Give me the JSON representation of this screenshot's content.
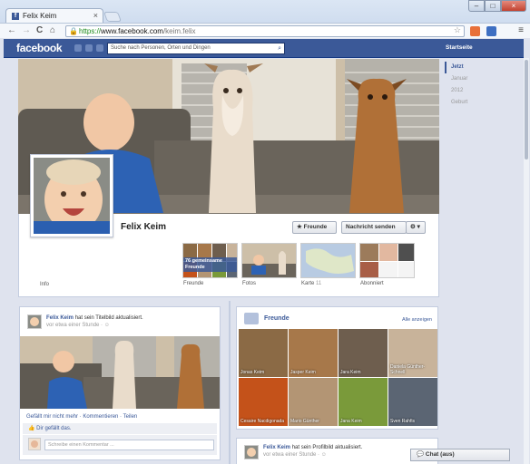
{
  "browser": {
    "tab_title": "Felix Keim",
    "tab_close": "×",
    "window_min": "–",
    "window_max": "□",
    "window_close": "×",
    "nav_back": "←",
    "nav_forward": "→",
    "nav_reload": "C",
    "nav_home": "⌂",
    "url_scheme": "https://",
    "url_domain": "www.facebook.com",
    "url_path": "/keim.felix",
    "menu": "≡"
  },
  "facebook_bar": {
    "logo": "facebook",
    "search_placeholder": "Suche nach Personen, Orten und Dingen",
    "home_link": "Startseite"
  },
  "scrubber": {
    "items": [
      "Jetzt",
      "Januar",
      "2012",
      "Geburt"
    ]
  },
  "profile": {
    "name": "Felix Keim",
    "friends_button": "★ Freunde",
    "message_button": "Nachricht senden",
    "gear_button": "⚙ ▾",
    "info_label": "Info",
    "mutual_friends_overlay": "76 gemeinsame Freunde",
    "tiles": [
      {
        "label": "Freunde"
      },
      {
        "label": "Fotos"
      },
      {
        "label": "Karte",
        "count": "11"
      },
      {
        "label": "Abonniert"
      }
    ]
  },
  "post1": {
    "author": "Felix Keim",
    "action": "hat sein Titelbild aktualisiert.",
    "time": "vor etwa einer Stunde · ☺",
    "actions": "Gefällt mir nicht mehr · Kommentieren · Teilen",
    "likes": "Dir gefällt das.",
    "comment_placeholder": "Schreibe einen Kommentar ..."
  },
  "friends_box": {
    "title": "Freunde",
    "show_all": "Alle anzeigen",
    "friends": [
      {
        "name": "Jonas Keim",
        "color": "#8b6a45"
      },
      {
        "name": "Jasper Keim",
        "color": "#a7784a"
      },
      {
        "name": "Jara Keim",
        "color": "#6e5e4e"
      },
      {
        "name": "Daniela Günther-Schnell",
        "color": "#c8b39a"
      },
      {
        "name": "Cesaire Nacdigonada",
        "color": "#c4521a"
      },
      {
        "name": "Mario Günther",
        "color": "#b39574"
      },
      {
        "name": "Jana Keim",
        "color": "#7a9a3a"
      },
      {
        "name": "Sven Rahfis",
        "color": "#5b6573"
      }
    ]
  },
  "post2": {
    "author": "Felix Keim",
    "action": "hat sein Profilbild aktualisiert.",
    "time": "vor etwa einer Stunde · ☺"
  },
  "chat": {
    "label": "💬 Chat (aus)"
  },
  "colors": {
    "facebook_blue": "#3b5998",
    "page_bg": "#dfe3ee"
  }
}
